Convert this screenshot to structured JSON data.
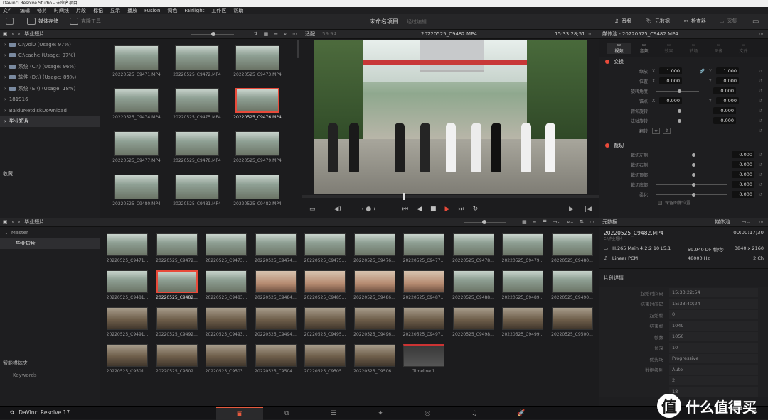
{
  "window": {
    "title": "DaVinci Resolve Studio - 未命名项目"
  },
  "menu": [
    "文件",
    "编辑",
    "修剪",
    "时间线",
    "片段",
    "标记",
    "显示",
    "播放",
    "Fusion",
    "调色",
    "Fairlight",
    "工作区",
    "帮助"
  ],
  "topbar": {
    "media_storage": "媒体存储",
    "clone_tool": "克隆工具",
    "project_name": "未命名项目",
    "edited": "经过编辑",
    "sound_library": "音频",
    "metadata": "元数据",
    "inspector": "检查器",
    "capture": "采集"
  },
  "left_panel": {
    "path_label": "毕业短片",
    "tree": [
      {
        "label": "C:\\vol0 (Usage: 97%)",
        "type": "disk"
      },
      {
        "label": "C:\\cache (Usage: 97%)",
        "type": "disk"
      },
      {
        "label": "系统 (C:\\) (Usage: 96%)",
        "type": "disk"
      },
      {
        "label": "软件 (D:\\) (Usage: 89%)",
        "type": "disk"
      },
      {
        "label": "系统 (E:\\) (Usage: 18%)",
        "type": "disk"
      },
      {
        "label": "181916",
        "type": "folder"
      },
      {
        "label": "BaiduNetdiskDownload",
        "type": "folder"
      },
      {
        "label": "毕业短片",
        "type": "folder",
        "selected": true
      }
    ],
    "favorites": "收藏"
  },
  "media_grid": {
    "items": [
      "20220525_C9471.MP4",
      "20220525_C9472.MP4",
      "20220525_C9473.MP4",
      "20220525_C9474.MP4",
      "20220525_C9475.MP4",
      "20220525_C9476.MP4",
      "20220525_C9477.MP4",
      "20220525_C9478.MP4",
      "20220525_C9479.MP4",
      "20220525_C9480.MP4",
      "20220525_C9481.MP4",
      "20220525_C9482.MP4"
    ],
    "selected_index": 5
  },
  "viewer": {
    "fit": "适配",
    "fps": "59.94",
    "clip_name": "20220525_C9482.MP4",
    "timecode": "15:33:28;51"
  },
  "inspector": {
    "title": "媒体池 - 20220525_C9482.MP4",
    "tabs": [
      "视频",
      "音频",
      "效果",
      "转场",
      "图像",
      "文件"
    ],
    "transform_title": "变换",
    "transform": [
      {
        "label": "缩放",
        "axis1": "X",
        "v1": "1.000",
        "axis2": "Y",
        "v2": "1.000"
      },
      {
        "label": "位置",
        "axis1": "X",
        "v1": "0.000",
        "axis2": "Y",
        "v2": "0.000"
      },
      {
        "label": "旋转角度",
        "v": "0.000"
      },
      {
        "label": "锚点",
        "axis1": "X",
        "v1": "0.000",
        "axis2": "Y",
        "v2": "0.000"
      },
      {
        "label": "俯仰旋转",
        "v": "0.000"
      },
      {
        "label": "法轴旋转",
        "v": "0.000"
      },
      {
        "label": "翻转"
      }
    ],
    "crop_title": "裁切",
    "crop": [
      {
        "label": "裁切左侧",
        "v": "0.000"
      },
      {
        "label": "裁切右侧",
        "v": "0.000"
      },
      {
        "label": "裁切顶部",
        "v": "0.000"
      },
      {
        "label": "裁切底部",
        "v": "0.000"
      },
      {
        "label": "柔化",
        "v": "0.000"
      }
    ],
    "retain_image_position": "保留图像位置"
  },
  "bin_panel": {
    "path_label": "毕业短片",
    "master": "Master",
    "sub": "毕业短片",
    "smart_bins": "智能媒体夹",
    "keywords": "Keywords"
  },
  "bin_grid": {
    "items": [
      "20220525_C9471...",
      "20220525_C9472...",
      "20220525_C9473...",
      "20220525_C9474...",
      "20220525_C9475...",
      "20220525_C9476...",
      "20220525_C9477...",
      "20220525_C9478...",
      "20220525_C9479...",
      "20220525_C9480...",
      "20220525_C9481...",
      "20220525_C9482...",
      "20220525_C9483...",
      "20220525_C9484...",
      "20220525_C9485...",
      "20220525_C9486...",
      "20220525_C9487...",
      "20220525_C9488...",
      "20220525_C9489...",
      "20220525_C9490...",
      "20220525_C9491...",
      "20220525_C9492...",
      "20220525_C9493...",
      "20220525_C9494...",
      "20220525_C9495...",
      "20220525_C9496...",
      "20220525_C9497...",
      "20220525_C9498...",
      "20220525_C9499...",
      "20220525_C9500...",
      "20220525_C9501...",
      "20220525_C9502...",
      "20220525_C9503...",
      "20220525_C9504...",
      "20220525_C9505...",
      "20220525_C9506...",
      "Timeline 1"
    ],
    "selected_index": 11
  },
  "metadata": {
    "title": "元数据",
    "panel_name": "媒体池",
    "clip_name": "20220525_C9482.MP4",
    "subtitle": "E:\\毕业短片",
    "duration": "00:00:17;30",
    "codec": "H.265 Main 4:2:2 10 L5.1",
    "fps": "59.940 DF 帧/秒",
    "resolution": "3840 x 2160",
    "audio": "Linear PCM",
    "sample_rate": "48000 Hz",
    "channels": "2 Ch",
    "details_title": "片段详情",
    "details": [
      {
        "k": "起始时间码",
        "v": "15:33:22;54"
      },
      {
        "k": "结束时间码",
        "v": "15:33:40;24"
      },
      {
        "k": "起始帧",
        "v": "0"
      },
      {
        "k": "结束帧",
        "v": "1049"
      },
      {
        "k": "帧数",
        "v": "1050"
      },
      {
        "k": "位深",
        "v": "10"
      },
      {
        "k": "优先场",
        "v": "Progressive"
      },
      {
        "k": "数据级别",
        "v": "Auto"
      },
      {
        "k": "",
        "v": "2"
      },
      {
        "k": "",
        "v": "18"
      }
    ]
  },
  "pagebar": {
    "app_name": "DaVinci Resolve 17",
    "pages": [
      "media-page-icon",
      "cut-page-icon",
      "edit-page-icon",
      "fusion-page-icon",
      "color-page-icon",
      "fairlight-page-icon",
      "deliver-page-icon"
    ]
  },
  "watermark": {
    "text": "什么值得买",
    "icon": "值"
  }
}
